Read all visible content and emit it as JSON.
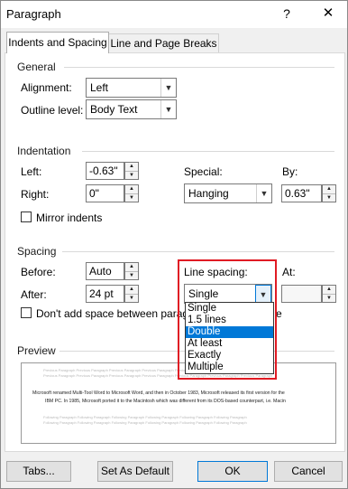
{
  "window": {
    "title": "Paragraph",
    "help_label": "?",
    "close_label": "✕"
  },
  "tabs": [
    {
      "label": "Indents and Spacing",
      "active": true
    },
    {
      "label": "Line and Page Breaks",
      "active": false
    }
  ],
  "general": {
    "heading": "General",
    "alignment": {
      "label": "Alignment:",
      "value": "Left"
    },
    "outline_level": {
      "label": "Outline level:",
      "value": "Body Text"
    }
  },
  "indentation": {
    "heading": "Indentation",
    "left": {
      "label": "Left:",
      "value": "-0.63\""
    },
    "right": {
      "label": "Right:",
      "value": "0\""
    },
    "special": {
      "label": "Special:",
      "value": "Hanging"
    },
    "by": {
      "label": "By:",
      "value": "0.63\""
    },
    "mirror_indents": {
      "label": "Mirror indents",
      "checked": false
    }
  },
  "spacing": {
    "heading": "Spacing",
    "before": {
      "label": "Before:",
      "value": "Auto"
    },
    "after": {
      "label": "After:",
      "value": "24 pt"
    },
    "line_spacing": {
      "label": "Line spacing:",
      "value": "Single",
      "options": [
        "Single",
        "1.5 lines",
        "Double",
        "At least",
        "Exactly",
        "Multiple"
      ],
      "highlighted": "Double"
    },
    "at": {
      "label": "At:",
      "value": ""
    },
    "dont_add_space": {
      "label_left": "Don't add space between paragra",
      "label_right": "e",
      "checked": false
    }
  },
  "preview": {
    "heading": "Preview",
    "previous_text": "Previous Paragraph Previous Paragraph Previous Paragraph Previous Paragraph Previous Paragraph Previous Paragraph Previous Paragraph",
    "body_line1": "Microsoft renamed Multi-Tool Word to Microsoft Word, and then in October 1983, Microsoft released its first version for the",
    "body_line2": "IBM PC. In 1985, Microsoft ported it to the Macintosh which was different from its DOS-based counterpart, i.e. Macin",
    "following_text": "Following Paragraph Following Paragraph Following Paragraph Following Paragraph Following Paragraph Following Paragraph"
  },
  "buttons": {
    "tabs": "Tabs...",
    "set_as_default": "Set As Default",
    "ok": "OK",
    "cancel": "Cancel"
  },
  "colors": {
    "accent": "#0078d7",
    "highlight_box": "#e01b24"
  }
}
